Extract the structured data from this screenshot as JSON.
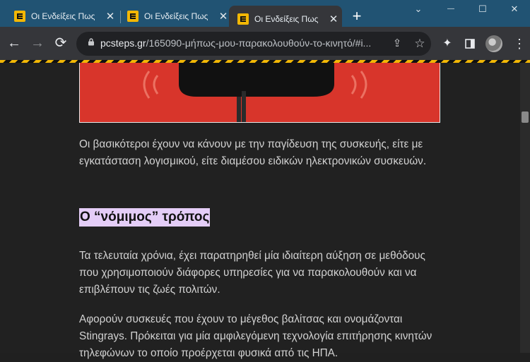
{
  "tabs": [
    {
      "title": "Οι Ενδείξεις Πως",
      "close": "✕"
    },
    {
      "title": "Οι Ενδείξεις Πως",
      "close": "✕"
    },
    {
      "title": "Οι Ενδείξεις Πως",
      "close": "✕"
    }
  ],
  "new_tab": "+",
  "window": {
    "minimize": "⌄",
    "restore": "—",
    "maximize": "☐",
    "close": "✕"
  },
  "nav": {
    "back": "←",
    "forward": "→",
    "reload": "⟳"
  },
  "url": {
    "host": "pcsteps.gr",
    "path": "/165090-μήπως-μου-παρακολουθούν-το-κινητό/#i..."
  },
  "colors": {
    "accent": "#f2b705",
    "tabstrip": "#215373",
    "highlight": "#e4cdf7",
    "hero": "#d8352b"
  },
  "article": {
    "p1": "Οι βασικότεροι έχουν να κάνουν με την παγίδευση της συσκευής, είτε με εγκατάσταση λογισμικού, είτε διαμέσου ειδικών ηλεκτρονικών συσκευών.",
    "heading": "Ο “νόμιμος” τρόπος",
    "p2": "Τα τελευταία χρόνια, έχει παρατηρηθεί μία ιδιαίτερη αύξηση σε μεθόδους που χρησιμοποιούν διάφορες υπηρεσίες για να παρακολουθούν και να επιβλέπουν τις ζωές πολιτών.",
    "p3": "Αφορούν συσκευές που έχουν το μέγεθος βαλίτσας και ονομάζονται Stingrays. Πρόκειται για μία αμφιλεγόμενη τεχνολογία επιτήρησης κινητών τηλεφώνων το οποίο προέρχεται φυσικά από τις ΗΠΑ."
  }
}
